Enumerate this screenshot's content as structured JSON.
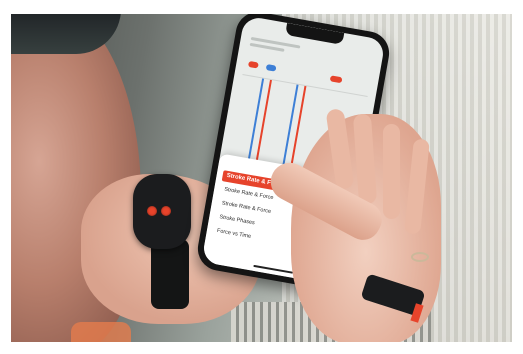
{
  "image": {
    "type": "photograph",
    "scene": "hands holding a smartphone with a menu open, wearing a sensor on a wrist strap"
  },
  "phone_screen": {
    "menu": {
      "selected_item": "Stroke Rate & Force",
      "items": [
        "Stroke Rate & Force",
        "Stroke Rate & Force",
        "Stroke Rate & Force",
        "Stroke Phases",
        "Force vs Time"
      ]
    }
  },
  "colors": {
    "accent": "#e6432b",
    "sensor_body": "#1b1c1e"
  }
}
